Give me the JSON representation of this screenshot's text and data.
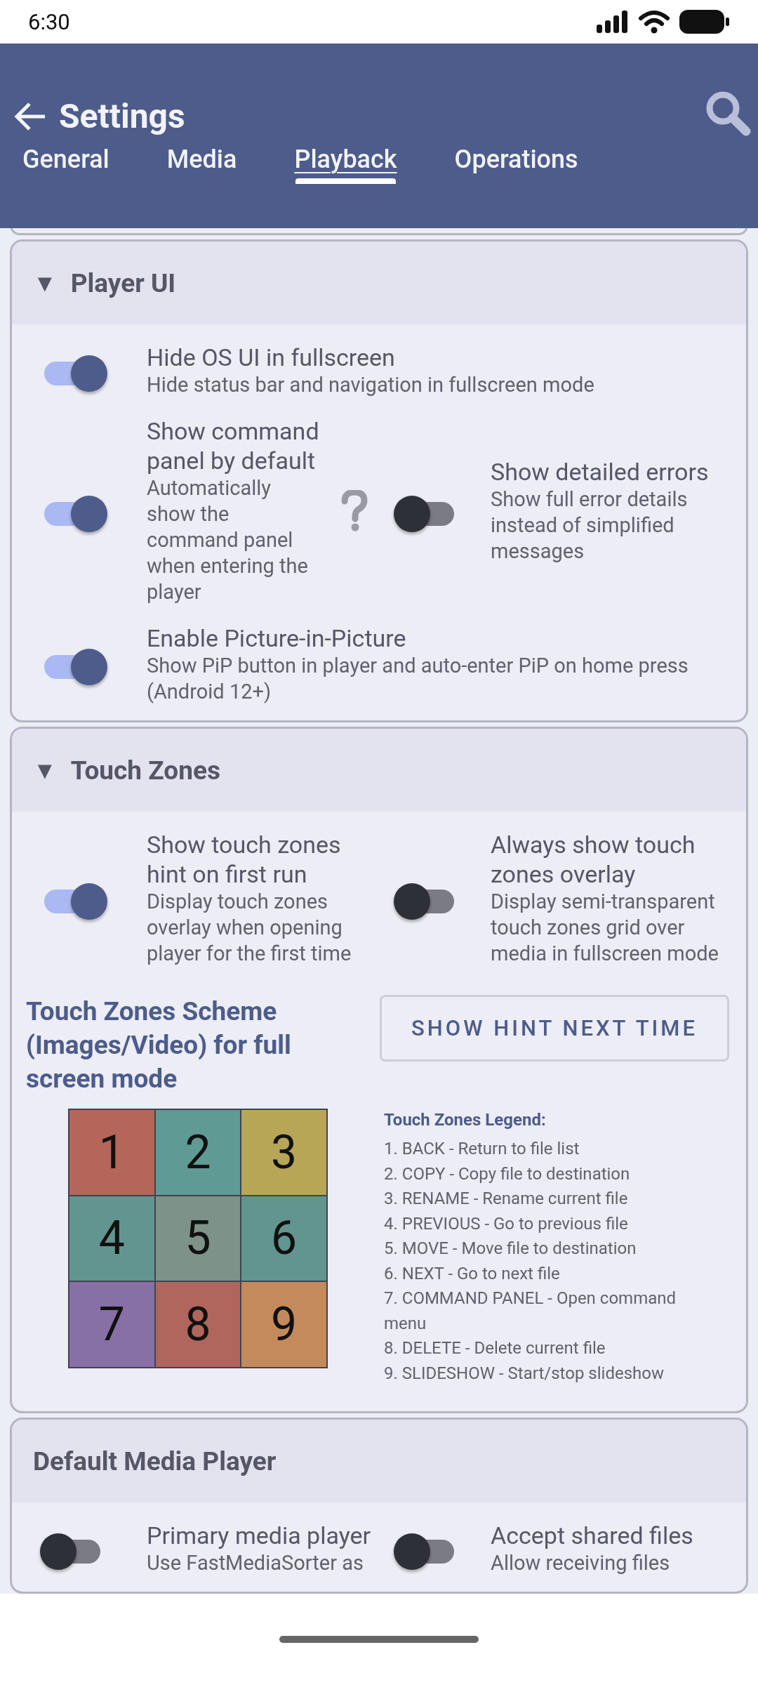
{
  "status_bar": {
    "time": "6:30"
  },
  "app_bar": {
    "title": "Settings"
  },
  "tabs": [
    {
      "label": "General",
      "selected": false
    },
    {
      "label": "Media",
      "selected": false
    },
    {
      "label": "Playback",
      "selected": true
    },
    {
      "label": "Operations",
      "selected": false
    }
  ],
  "sections": [
    {
      "title": "Player UI",
      "arrow": "▼",
      "rows": [
        [
          {
            "title": "Hide OS UI in fullscreen",
            "description": "Hide status bar and navigation in fullscreen mode",
            "on": true
          }
        ],
        [
          {
            "title": "Show command panel by default",
            "description": "Automatically show the command panel when entering the player",
            "on": true,
            "help": true
          },
          {
            "title": "Show detailed errors",
            "description": "Show full error details instead of simplified messages",
            "on": false
          }
        ],
        [
          {
            "title": "Enable Picture-in-Picture",
            "description": "Show PiP button in player and auto-enter PiP on home press (Android 12+)",
            "on": true
          }
        ]
      ]
    },
    {
      "title": "Touch Zones",
      "arrow": "▼",
      "rows": [
        [
          {
            "title": "Show touch zones hint on first run",
            "description": "Display touch zones overlay when opening player for the first time",
            "on": true
          },
          {
            "title": "Always show touch zones overlay",
            "description": "Display semi-transparent touch zones grid over media in fullscreen mode",
            "on": false
          }
        ]
      ],
      "scheme": {
        "title": "Touch Zones Scheme (Images/Video) for full screen mode",
        "button": "SHOW HINT NEXT TIME",
        "zones": [
          {
            "label": "1",
            "color": "#b5655a"
          },
          {
            "label": "2",
            "color": "#5f9a94"
          },
          {
            "label": "3",
            "color": "#b8a657"
          },
          {
            "label": "4",
            "color": "#62958f"
          },
          {
            "label": "5",
            "color": "#7d9289"
          },
          {
            "label": "6",
            "color": "#62958f"
          },
          {
            "label": "7",
            "color": "#8770a6"
          },
          {
            "label": "8",
            "color": "#b0665c"
          },
          {
            "label": "9",
            "color": "#c58a5c"
          }
        ],
        "legend_title": "Touch Zones Legend:",
        "legend": [
          "1. BACK - Return to file list",
          "2. COPY - Copy file to destination",
          "3. RENAME - Rename current file",
          "4. PREVIOUS - Go to previous file",
          "5. MOVE - Move file to destination",
          "6. NEXT - Go to next file",
          "7. COMMAND PANEL - Open command menu",
          "8. DELETE - Delete current file",
          "9. SLIDESHOW - Start/stop slideshow"
        ]
      }
    },
    {
      "title": "Default Media Player",
      "rows": [
        [
          {
            "title": "Primary media player",
            "description": "Use FastMediaSorter as",
            "on": false
          },
          {
            "title": "Accept shared files",
            "description": "Allow receiving files",
            "on": false
          }
        ]
      ]
    }
  ]
}
